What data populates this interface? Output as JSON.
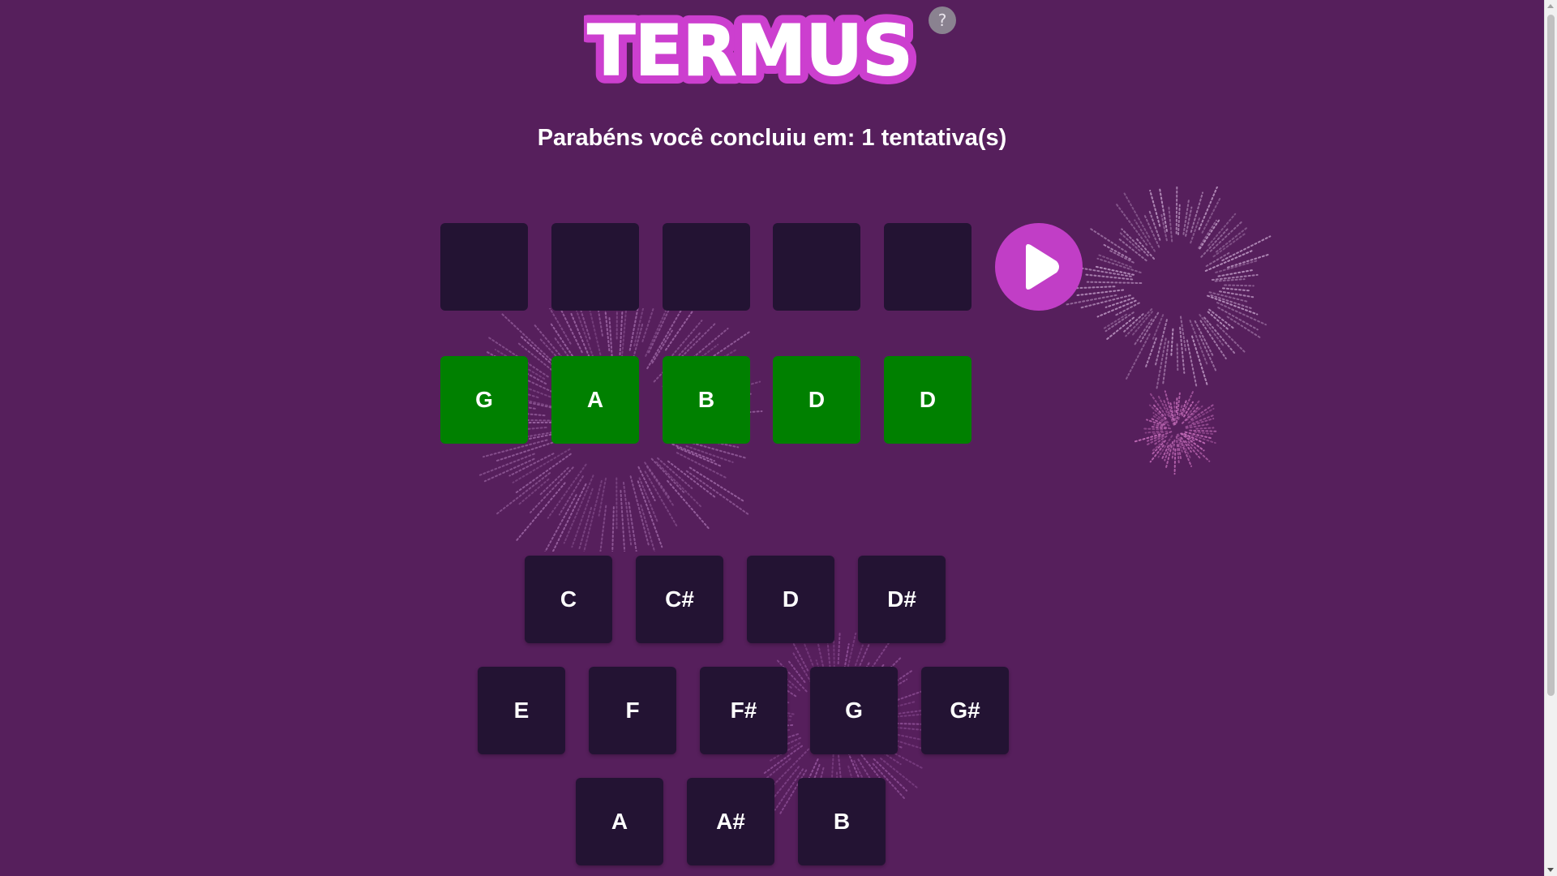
{
  "logo": {
    "text": "TERMUS"
  },
  "help": {
    "label": "?"
  },
  "message": "Parabéns você concluiu em: 1 tentativa(s)",
  "attempt_rows": [
    {
      "notes": [
        "",
        "",
        "",
        "",
        ""
      ],
      "status": "empty"
    },
    {
      "notes": [
        "G",
        "A",
        "B",
        "D",
        "D"
      ],
      "status": "correct"
    }
  ],
  "keyboard": {
    "row1": [
      "C",
      "C#",
      "D",
      "D#"
    ],
    "row2": [
      "E",
      "F",
      "F#",
      "G",
      "G#"
    ],
    "row3": [
      "A",
      "A#",
      "B"
    ]
  },
  "colors": {
    "background": "#561f5c",
    "tile_dark": "#231333",
    "tile_correct": "#008000",
    "play_button": "#c13ec6",
    "logo_fill": "#ffffff",
    "logo_outline": "#cc3fcf"
  },
  "icons": {
    "play": "play-icon",
    "help": "question-mark-icon"
  }
}
